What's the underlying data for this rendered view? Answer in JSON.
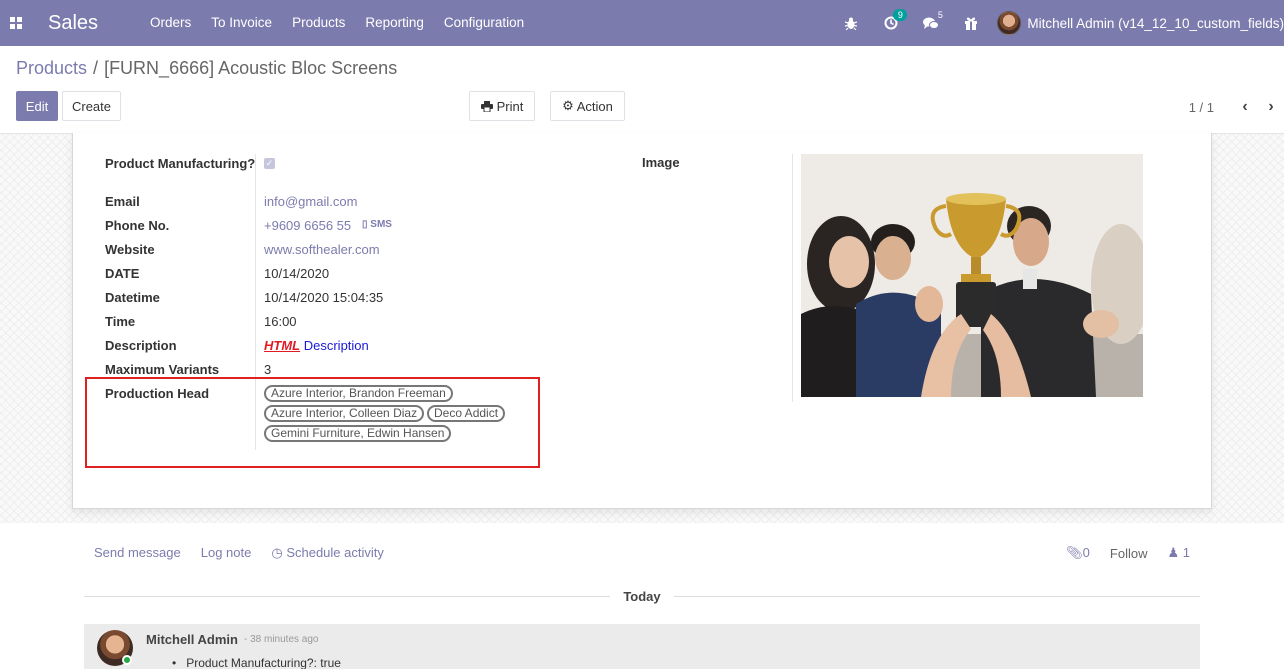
{
  "navbar": {
    "app_name": "Sales",
    "menu": [
      "Orders",
      "To Invoice",
      "Products",
      "Reporting",
      "Configuration"
    ],
    "activity_badge": "9",
    "messages_badge": "5",
    "user_name": "Mitchell Admin (v14_12_10_custom_fields)",
    "color": "#7c7bad"
  },
  "breadcrumb": {
    "parent": "Products",
    "separator": "/",
    "current": "[FURN_6666] Acoustic Bloc Screens"
  },
  "buttons": {
    "edit": "Edit",
    "create": "Create",
    "print": "Print",
    "action": "Action"
  },
  "pager": {
    "value": "1 / 1"
  },
  "form": {
    "fields": [
      {
        "label": "Product Manufacturing?",
        "value": "checked"
      },
      {
        "label": "Email",
        "value": "info@gmail.com"
      },
      {
        "label": "Phone No.",
        "value": "+9609 6656 55",
        "extra": "SMS"
      },
      {
        "label": "Website",
        "value": "www.softhealer.com"
      },
      {
        "label": "DATE",
        "value": "10/14/2020"
      },
      {
        "label": "Datetime",
        "value": "10/14/2020 15:04:35"
      },
      {
        "label": "Time",
        "value": "16:00"
      },
      {
        "label": "Description",
        "value_html": "HTML",
        "value_text": "Description"
      },
      {
        "label": "Maximum Variants",
        "value": "3"
      },
      {
        "label": "Production Head",
        "tags": [
          "Azure Interior, Brandon Freeman",
          "Azure Interior, Colleen Diaz",
          "Deco Addict",
          "Gemini Furniture, Edwin Hansen"
        ]
      }
    ],
    "image_label": "Image"
  },
  "chatter": {
    "send_message": "Send message",
    "log_note": "Log note",
    "schedule_activity": "Schedule activity",
    "attachments": "0",
    "follow": "Follow",
    "followers": "1",
    "date_separator": "Today",
    "message": {
      "author": "Mitchell Admin",
      "time": "- 38 minutes ago",
      "bullet": "Product Manufacturing?: true"
    }
  }
}
